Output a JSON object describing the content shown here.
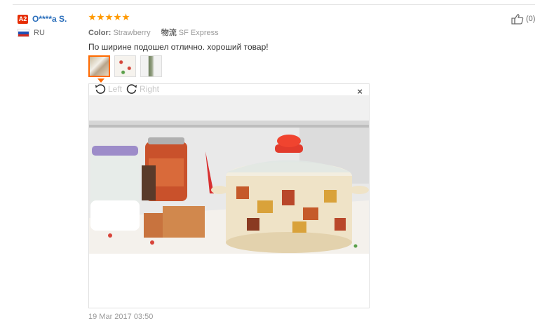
{
  "buyer": {
    "level_badge": "A2",
    "name": "O****a S.",
    "country": "RU"
  },
  "review": {
    "rating": 5,
    "color_label": "Color:",
    "color_value": "Strawberry",
    "shipping_label": "物流",
    "shipping_value": "SF Express",
    "comment": "По ширине подошел отлично. хороший товар!",
    "date": "19 Mar 2017 03:50",
    "helpful_count": "(0)"
  },
  "viewer": {
    "rotate_left": "Left",
    "rotate_right": "Right",
    "close_glyph": "×"
  },
  "thumbnails": [
    {
      "name": "photo-1",
      "selected": true
    },
    {
      "name": "photo-2",
      "selected": false
    },
    {
      "name": "photo-3",
      "selected": false
    }
  ],
  "colors": {
    "accent": "#ff6a00",
    "star": "#ff9900",
    "link": "#2a6ebb",
    "badge": "#e62e04"
  },
  "icons": [
    "rotate-left-icon",
    "rotate-right-icon",
    "close-icon",
    "thumbs-up-icon",
    "russia-flag-icon"
  ]
}
